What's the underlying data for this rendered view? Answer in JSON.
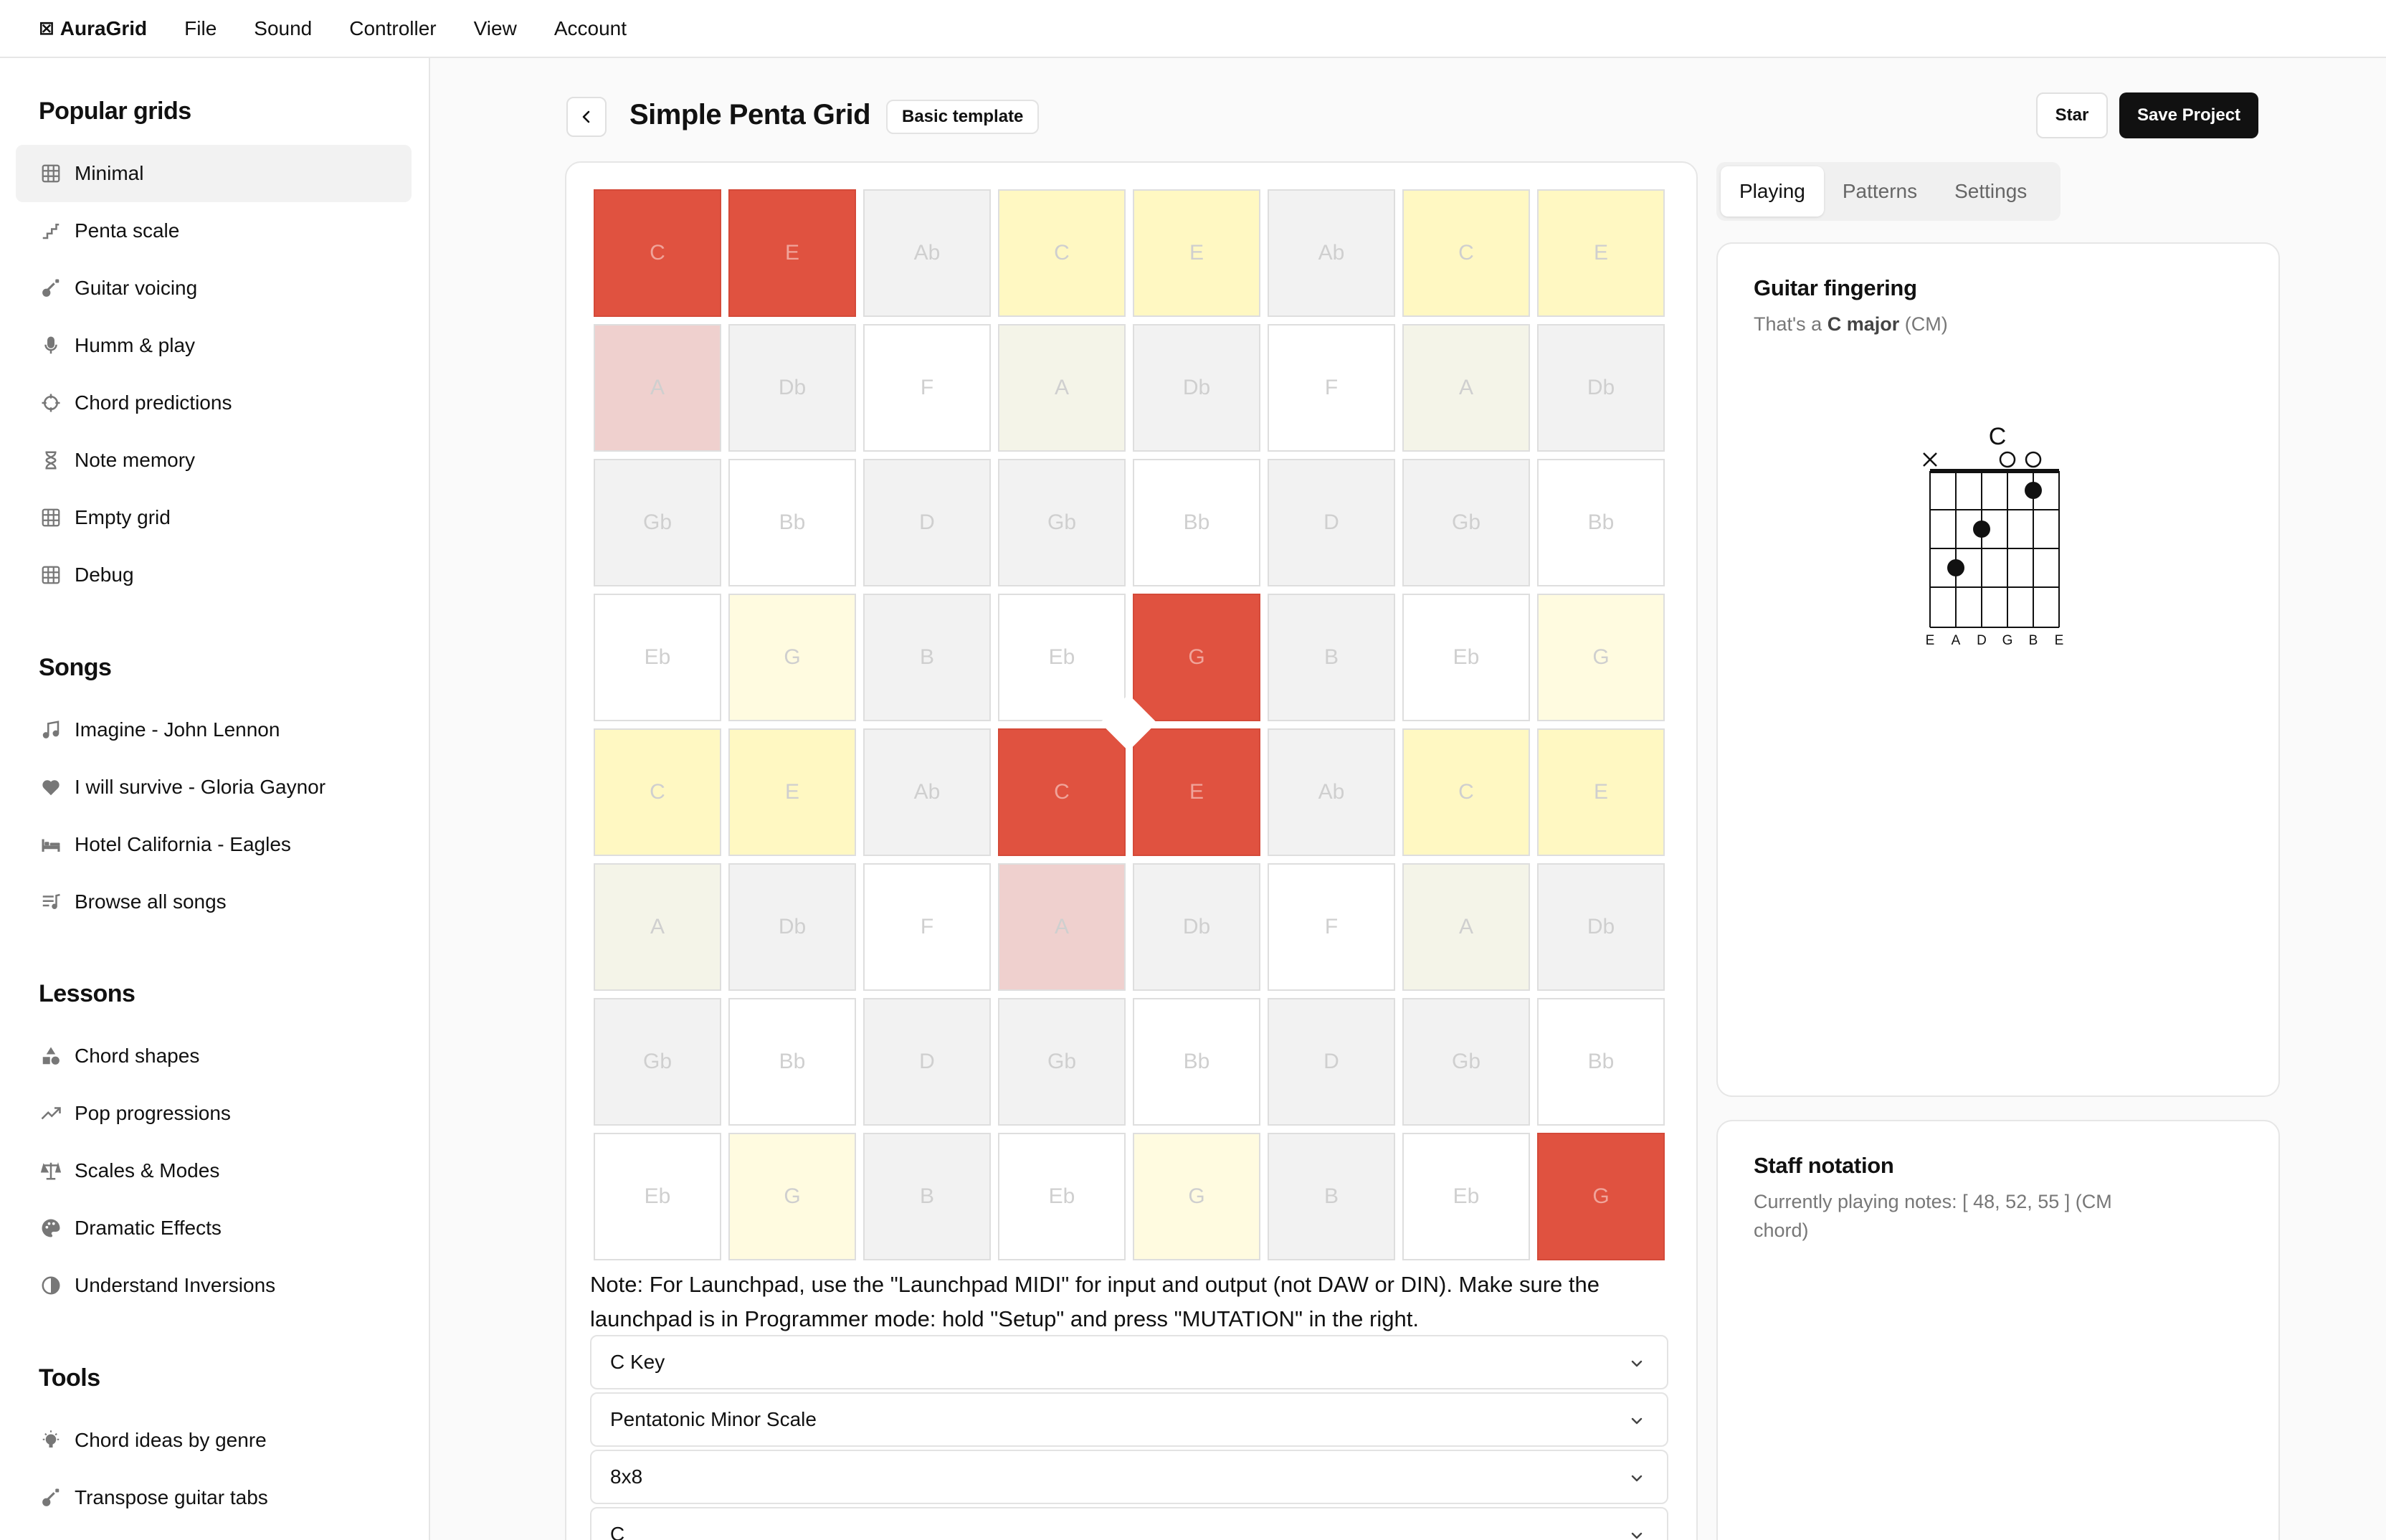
{
  "app": {
    "name": "AuraGrid",
    "logo_glyph": "⊠"
  },
  "menu": [
    "File",
    "Sound",
    "Controller",
    "View",
    "Account"
  ],
  "sidebar": {
    "popular_title": "Popular grids",
    "popular": [
      {
        "label": "Minimal",
        "icon": "grid-icon"
      },
      {
        "label": "Penta scale",
        "icon": "stairs-icon"
      },
      {
        "label": "Guitar voicing",
        "icon": "guitar-icon"
      },
      {
        "label": "Humm & play",
        "icon": "microphone-icon"
      },
      {
        "label": "Chord predictions",
        "icon": "crosshair-icon"
      },
      {
        "label": "Note memory",
        "icon": "hourglass-icon"
      },
      {
        "label": "Empty grid",
        "icon": "grid-icon"
      },
      {
        "label": "Debug",
        "icon": "grid-icon"
      }
    ],
    "songs_title": "Songs",
    "songs": [
      {
        "label": "Imagine - John Lennon",
        "icon": "music-note-icon"
      },
      {
        "label": "I will survive - Gloria Gaynor",
        "icon": "heart-icon"
      },
      {
        "label": "Hotel California - Eagles",
        "icon": "bed-icon"
      },
      {
        "label": "Browse all songs",
        "icon": "playlist-icon"
      }
    ],
    "lessons_title": "Lessons",
    "lessons": [
      {
        "label": "Chord shapes",
        "icon": "shapes-icon"
      },
      {
        "label": "Pop progressions",
        "icon": "trending-icon"
      },
      {
        "label": "Scales & Modes",
        "icon": "scales-icon"
      },
      {
        "label": "Dramatic Effects",
        "icon": "palette-icon"
      },
      {
        "label": "Understand Inversions",
        "icon": "contrast-icon"
      }
    ],
    "tools_title": "Tools",
    "tools": [
      {
        "label": "Chord ideas by genre",
        "icon": "lightbulb-icon"
      },
      {
        "label": "Transpose guitar tabs",
        "icon": "guitar-icon"
      }
    ]
  },
  "header": {
    "title": "Simple Penta Grid",
    "badge": "Basic template",
    "star_label": "Star",
    "save_label": "Save Project"
  },
  "grid": {
    "colors": {
      "red": "#e05240",
      "pink": "#efd0ce",
      "yellow": "#fff8c2",
      "ylight": "#fffbe0",
      "cream": "#f4f4e8",
      "gray": "#f2f2f2",
      "white": "#ffffff"
    },
    "rows": [
      [
        {
          "n": "C",
          "s": "red"
        },
        {
          "n": "E",
          "s": "red"
        },
        {
          "n": "Ab",
          "s": "gray"
        },
        {
          "n": "C",
          "s": "yellow"
        },
        {
          "n": "E",
          "s": "yellow"
        },
        {
          "n": "Ab",
          "s": "gray"
        },
        {
          "n": "C",
          "s": "yellow"
        },
        {
          "n": "E",
          "s": "yellow"
        }
      ],
      [
        {
          "n": "A",
          "s": "pink"
        },
        {
          "n": "Db",
          "s": "gray"
        },
        {
          "n": "F",
          "s": "white"
        },
        {
          "n": "A",
          "s": "cream"
        },
        {
          "n": "Db",
          "s": "gray"
        },
        {
          "n": "F",
          "s": "white"
        },
        {
          "n": "A",
          "s": "cream"
        },
        {
          "n": "Db",
          "s": "gray"
        }
      ],
      [
        {
          "n": "Gb",
          "s": "gray"
        },
        {
          "n": "Bb",
          "s": "white"
        },
        {
          "n": "D",
          "s": "gray"
        },
        {
          "n": "Gb",
          "s": "gray"
        },
        {
          "n": "Bb",
          "s": "white"
        },
        {
          "n": "D",
          "s": "gray"
        },
        {
          "n": "Gb",
          "s": "gray"
        },
        {
          "n": "Bb",
          "s": "white"
        }
      ],
      [
        {
          "n": "Eb",
          "s": "white"
        },
        {
          "n": "G",
          "s": "ylight"
        },
        {
          "n": "B",
          "s": "gray"
        },
        {
          "n": "Eb",
          "s": "white"
        },
        {
          "n": "G",
          "s": "red"
        },
        {
          "n": "B",
          "s": "gray"
        },
        {
          "n": "Eb",
          "s": "white"
        },
        {
          "n": "G",
          "s": "ylight"
        }
      ],
      [
        {
          "n": "C",
          "s": "yellow"
        },
        {
          "n": "E",
          "s": "yellow"
        },
        {
          "n": "Ab",
          "s": "gray"
        },
        {
          "n": "C",
          "s": "red"
        },
        {
          "n": "E",
          "s": "red"
        },
        {
          "n": "Ab",
          "s": "gray"
        },
        {
          "n": "C",
          "s": "yellow"
        },
        {
          "n": "E",
          "s": "yellow"
        }
      ],
      [
        {
          "n": "A",
          "s": "cream"
        },
        {
          "n": "Db",
          "s": "gray"
        },
        {
          "n": "F",
          "s": "white"
        },
        {
          "n": "A",
          "s": "pink"
        },
        {
          "n": "Db",
          "s": "gray"
        },
        {
          "n": "F",
          "s": "white"
        },
        {
          "n": "A",
          "s": "cream"
        },
        {
          "n": "Db",
          "s": "gray"
        }
      ],
      [
        {
          "n": "Gb",
          "s": "gray"
        },
        {
          "n": "Bb",
          "s": "white"
        },
        {
          "n": "D",
          "s": "gray"
        },
        {
          "n": "Gb",
          "s": "gray"
        },
        {
          "n": "Bb",
          "s": "white"
        },
        {
          "n": "D",
          "s": "gray"
        },
        {
          "n": "Gb",
          "s": "gray"
        },
        {
          "n": "Bb",
          "s": "white"
        }
      ],
      [
        {
          "n": "Eb",
          "s": "white"
        },
        {
          "n": "G",
          "s": "ylight"
        },
        {
          "n": "B",
          "s": "gray"
        },
        {
          "n": "Eb",
          "s": "white"
        },
        {
          "n": "G",
          "s": "ylight"
        },
        {
          "n": "B",
          "s": "gray"
        },
        {
          "n": "Eb",
          "s": "white"
        },
        {
          "n": "G",
          "s": "red"
        }
      ]
    ]
  },
  "note_text": "Note: For Launchpad, use the \"Launchpad MIDI\" for input and output (not DAW or DIN). Make sure the launchpad is in Programmer mode: hold \"Setup\" and press \"MUTATION\" in the right.",
  "selects": [
    "C Key",
    "Pentatonic Minor Scale",
    "8x8",
    "C"
  ],
  "tabs": [
    "Playing",
    "Patterns",
    "Settings"
  ],
  "active_tab": "Playing",
  "guitar_card": {
    "title": "Guitar fingering",
    "sub_prefix": "That's a ",
    "chord_bold": "C major",
    "chord_suffix": " (CM)",
    "diagram_chord": "C",
    "strings": [
      "E",
      "A",
      "D",
      "G",
      "B",
      "E"
    ]
  },
  "staff_card": {
    "title": "Staff notation",
    "sub": "Currently playing notes: [ 48, 52, 55 ] (CM chord)"
  }
}
